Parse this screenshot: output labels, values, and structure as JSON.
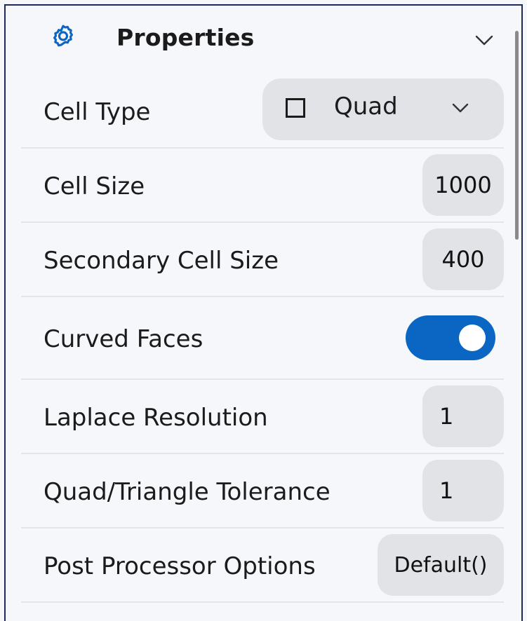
{
  "panel": {
    "title": "Properties",
    "icon": "gear-icon",
    "collapse_icon": "chevron-down-icon",
    "accent_color": "#0a66c2"
  },
  "properties": {
    "cell_type": {
      "label": "Cell Type",
      "value": "Quad",
      "icon": "square-outline-icon"
    },
    "cell_size": {
      "label": "Cell Size",
      "value": "1000"
    },
    "secondary_cell_size": {
      "label": "Secondary Cell Size",
      "value": "400"
    },
    "curved_faces": {
      "label": "Curved Faces",
      "enabled": true
    },
    "laplace_resolution": {
      "label": "Laplace Resolution",
      "value": "1"
    },
    "quad_triangle_tolerance": {
      "label": "Quad/Triangle Tolerance",
      "value": "1"
    },
    "post_processor_options": {
      "label": "Post Processor Options",
      "value": "Default()"
    }
  }
}
